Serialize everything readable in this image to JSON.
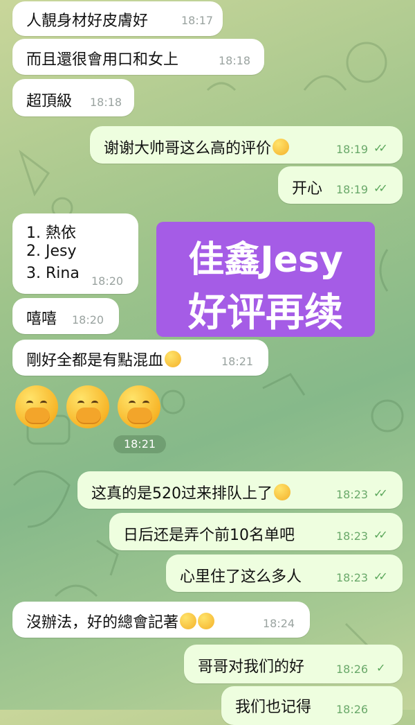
{
  "messages": [
    {
      "text": "人靚身材好皮膚好",
      "time": "18:17"
    },
    {
      "text": "而且還很會用口和女上",
      "time": "18:18"
    },
    {
      "text": "超頂級",
      "time": "18:18"
    },
    {
      "text": "谢谢大帅哥这么高的评价",
      "time": "18:19"
    },
    {
      "text": "开心",
      "time": "18:19"
    },
    {
      "lines": [
        "1. 熱依",
        "2. Jesy",
        "3. Rina"
      ],
      "time": "18:20"
    },
    {
      "text": "嘻嘻",
      "time": "18:20"
    },
    {
      "text": "剛好全都是有點混血",
      "time": "18:21"
    },
    {
      "emoji_time": "18:21"
    },
    {
      "text": "这真的是520过来排队上了",
      "time": "18:23"
    },
    {
      "text": "日后还是弄个前10名单吧",
      "time": "18:23"
    },
    {
      "text": "心里住了这么多人",
      "time": "18:23"
    },
    {
      "text": "沒辦法，好的總會記著",
      "time": "18:24"
    },
    {
      "text": "哥哥对我们的好",
      "time": "18:26"
    },
    {
      "text": "我们也记得",
      "time": "18:26"
    }
  ],
  "overlay": {
    "line1": "佳鑫Jesy",
    "line2": "好评再续"
  },
  "colors": {
    "incoming": "#ffffff",
    "outgoing": "#eefedf",
    "overlay": "#a55ce6",
    "check": "#5aa65a"
  },
  "icons": [
    "double-check-icon",
    "single-check-icon",
    "hand-over-mouth-emoji",
    "partying-face-emoji",
    "tears-of-joy-emoji",
    "grinning-squint-emoji",
    "rolling-laughing-emoji"
  ]
}
